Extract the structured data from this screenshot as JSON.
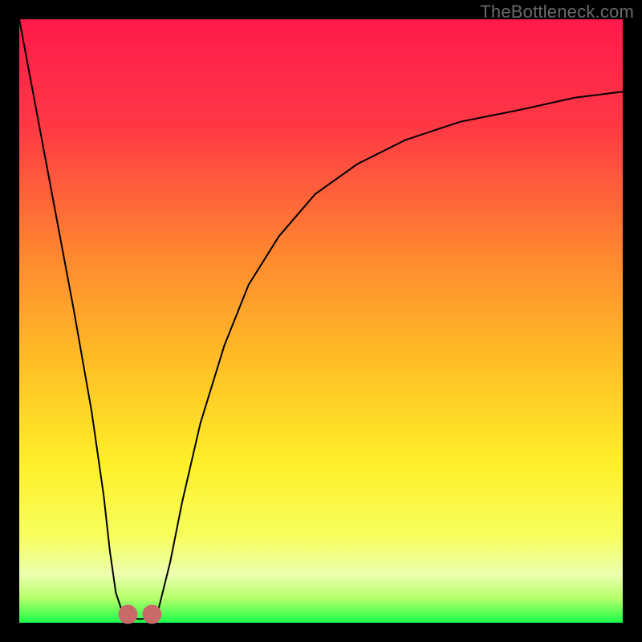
{
  "watermark": "TheBottleneck.com",
  "gradient": {
    "stops": [
      {
        "pct": 0,
        "color": "#ff1a4b"
      },
      {
        "pct": 18,
        "color": "#ff3944"
      },
      {
        "pct": 40,
        "color": "#ff8b2f"
      },
      {
        "pct": 58,
        "color": "#ffc225"
      },
      {
        "pct": 74,
        "color": "#fff02a"
      },
      {
        "pct": 86,
        "color": "#f6ff60"
      },
      {
        "pct": 92,
        "color": "#edffb0"
      },
      {
        "pct": 96,
        "color": "#b4ff6a"
      },
      {
        "pct": 100,
        "color": "#1aff4a"
      }
    ]
  },
  "curve_style": {
    "stroke": "#000000",
    "stroke_width": 2
  },
  "marker_style": {
    "fill": "#c96a6a",
    "radius": 12
  },
  "chart_data": {
    "type": "line",
    "title": "",
    "xlabel": "",
    "ylabel": "",
    "xlim": [
      0,
      100
    ],
    "ylim": [
      0,
      100
    ],
    "notes": "Abstract bottleneck-style curve on a red→green vertical gradient. No axis ticks or numeric labels are shown; the curve shape and marker positions are estimated in 0–100 normalized space where y=0 is the bottom (green) and y=100 is the top (red).",
    "series": [
      {
        "name": "left-branch",
        "x": [
          0,
          3,
          6,
          9,
          12,
          14,
          15,
          16,
          17
        ],
        "y": [
          100,
          84,
          68,
          52,
          35,
          21,
          12,
          5,
          2
        ]
      },
      {
        "name": "valley",
        "x": [
          17,
          18,
          19,
          20,
          21,
          22,
          23
        ],
        "y": [
          2,
          1,
          0.7,
          0.6,
          0.7,
          1,
          2
        ]
      },
      {
        "name": "right-branch",
        "x": [
          23,
          25,
          27,
          30,
          34,
          38,
          43,
          49,
          56,
          64,
          73,
          83,
          92,
          100
        ],
        "y": [
          2,
          10,
          20,
          33,
          46,
          56,
          64,
          71,
          76,
          80,
          83,
          85,
          87,
          88
        ]
      }
    ],
    "markers": {
      "name": "valley-markers",
      "x": [
        18,
        22
      ],
      "y": [
        1.4,
        1.4
      ]
    }
  }
}
